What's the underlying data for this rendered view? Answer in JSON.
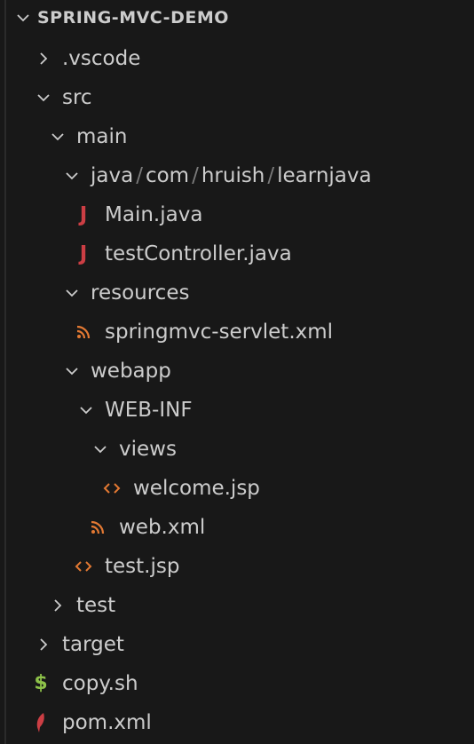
{
  "explorer": {
    "root": {
      "label": "SPRING-MVC-DEMO",
      "expanded": true
    },
    "items": [
      {
        "label": ".vscode",
        "type": "folder",
        "expanded": false,
        "depth": 1
      },
      {
        "label": "src",
        "type": "folder",
        "expanded": true,
        "depth": 1
      },
      {
        "label": "main",
        "type": "folder",
        "expanded": true,
        "depth": 2
      },
      {
        "label": "java/com/hruish/learnjava",
        "segments": [
          "java",
          "com",
          "hruish",
          "learnjava"
        ],
        "type": "folder",
        "expanded": true,
        "depth": 3
      },
      {
        "label": "Main.java",
        "type": "file",
        "icon": "java-icon",
        "depth": 4
      },
      {
        "label": "testController.java",
        "type": "file",
        "icon": "java-icon",
        "depth": 4
      },
      {
        "label": "resources",
        "type": "folder",
        "expanded": true,
        "depth": 3
      },
      {
        "label": "springmvc-servlet.xml",
        "type": "file",
        "icon": "xml-rss-icon",
        "depth": 4
      },
      {
        "label": "webapp",
        "type": "folder",
        "expanded": true,
        "depth": 3
      },
      {
        "label": "WEB-INF",
        "type": "folder",
        "expanded": true,
        "depth": 4
      },
      {
        "label": "views",
        "type": "folder",
        "expanded": true,
        "depth": 5
      },
      {
        "label": "welcome.jsp",
        "type": "file",
        "icon": "jsp-code-icon",
        "depth": 6
      },
      {
        "label": "web.xml",
        "type": "file",
        "icon": "xml-rss-icon",
        "depth": 5
      },
      {
        "label": "test.jsp",
        "type": "file",
        "icon": "jsp-code-icon",
        "depth": 4
      },
      {
        "label": "test",
        "type": "folder",
        "expanded": false,
        "depth": 2
      },
      {
        "label": "target",
        "type": "folder",
        "expanded": false,
        "depth": 1
      },
      {
        "label": "copy.sh",
        "type": "file",
        "icon": "shell-dollar-icon",
        "depth": 1
      },
      {
        "label": "pom.xml",
        "type": "file",
        "icon": "maven-feather-icon",
        "depth": 1
      }
    ],
    "colors": {
      "background": "#181818",
      "text": "#cccccc",
      "java": "#cc3e44",
      "xml": "#e37933",
      "jsp": "#e37933",
      "shell": "#8dc149",
      "maven": "#cc3e44"
    }
  }
}
